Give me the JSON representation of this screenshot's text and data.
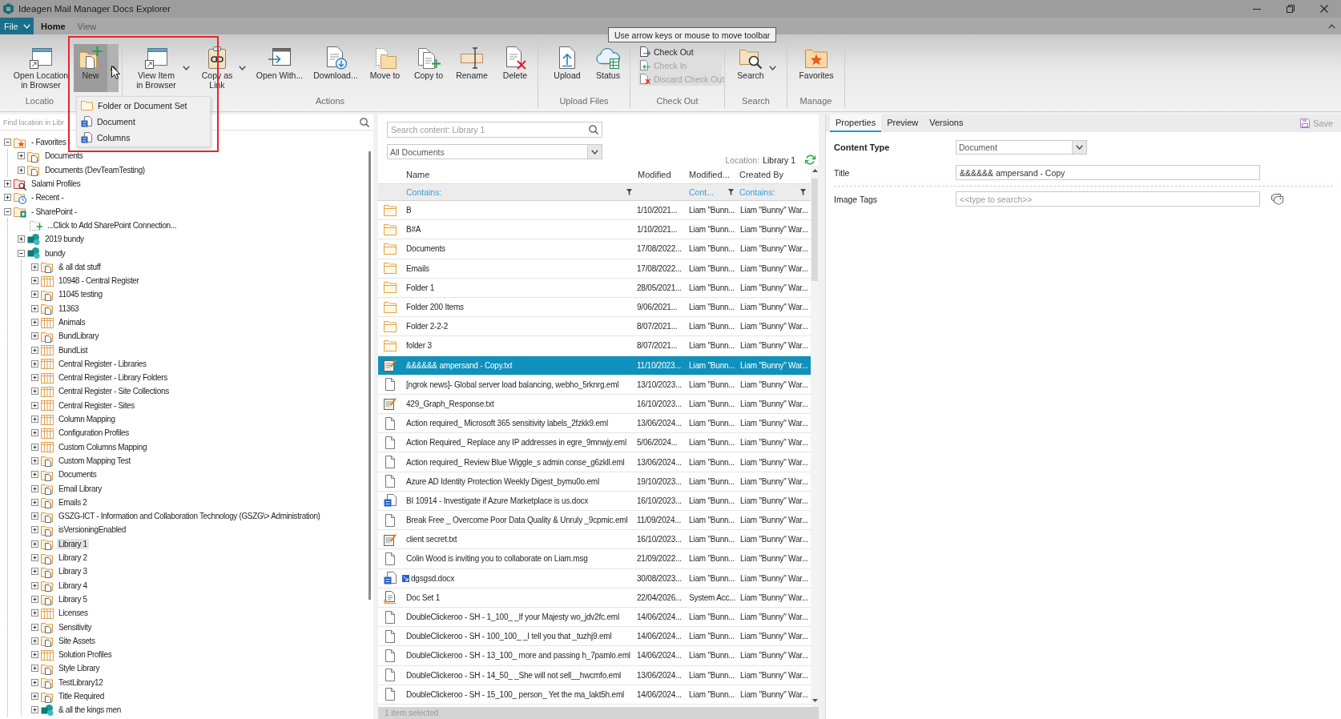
{
  "window": {
    "title": "Ideagen Mail Manager Docs Explorer"
  },
  "menu_tabs": [
    {
      "label": "File",
      "kind": "file",
      "selected": false
    },
    {
      "label": "Home",
      "kind": "tab",
      "selected": true
    },
    {
      "label": "View",
      "kind": "tab",
      "selected": false
    }
  ],
  "ribbon": {
    "groups": [
      {
        "buttons": [
          {
            "label": "Open Location\nin Browser",
            "kind": "large",
            "dropdown": false,
            "open": false,
            "disabled": false
          },
          {
            "label": "New",
            "kind": "large",
            "dropdown": true,
            "open": true,
            "disabled": false
          }
        ],
        "label": "Locatio"
      },
      {
        "buttons": [
          {
            "label": "View Item\nin Browser",
            "kind": "large",
            "dropdown": true,
            "open": false,
            "disabled": false
          },
          {
            "label": "Copy as\nLink",
            "kind": "large",
            "dropdown": true,
            "open": false,
            "disabled": false
          },
          {
            "label": "Open With...",
            "kind": "large",
            "dropdown": false,
            "open": false,
            "disabled": false
          },
          {
            "label": "Download...",
            "kind": "large",
            "dropdown": false,
            "open": false,
            "disabled": false
          },
          {
            "label": "Move to",
            "kind": "large",
            "dropdown": false,
            "open": false,
            "disabled": false
          },
          {
            "label": "Copy to",
            "kind": "large",
            "dropdown": false,
            "open": false,
            "disabled": false
          },
          {
            "label": "Rename",
            "kind": "large",
            "dropdown": false,
            "open": false,
            "disabled": false
          },
          {
            "label": "Delete",
            "kind": "large",
            "dropdown": false,
            "open": false,
            "disabled": false
          }
        ],
        "label": "Actions"
      },
      {
        "buttons": [
          {
            "label": "Upload",
            "kind": "large",
            "dropdown": false,
            "open": false,
            "disabled": false
          },
          {
            "label": "Status",
            "kind": "large",
            "dropdown": false,
            "open": false,
            "disabled": false
          }
        ],
        "label": "Upload Files"
      },
      {
        "buttons": [
          {
            "label": "Check Out",
            "kind": "small",
            "dropdown": false,
            "open": false,
            "disabled": false
          },
          {
            "label": "Check In",
            "kind": "small",
            "dropdown": false,
            "open": false,
            "disabled": true
          },
          {
            "label": "Discard Check Out",
            "kind": "small",
            "dropdown": false,
            "open": false,
            "disabled": true
          }
        ],
        "label": "Check Out"
      },
      {
        "buttons": [
          {
            "label": "Search",
            "kind": "large",
            "dropdown": true,
            "open": false,
            "disabled": false
          }
        ],
        "label": "Search"
      },
      {
        "buttons": [
          {
            "label": "Favorites",
            "kind": "large",
            "dropdown": false,
            "open": false,
            "disabled": false
          }
        ],
        "label": "Manage"
      }
    ]
  },
  "tooltip": {
    "text": "Use arrow keys or mouse to move toolbar"
  },
  "new_menu": {
    "items": [
      {
        "label": "Folder or Document Set",
        "kind": "folder"
      },
      {
        "label": "Document",
        "kind": "document"
      },
      {
        "label": "Columns",
        "kind": "document"
      }
    ]
  },
  "left_pane": {
    "find": {
      "placeholder": "Find location in Libr"
    },
    "tree": [
      {
        "label": "- Favorites -",
        "kind": "favorites",
        "expanded": true,
        "selected": false,
        "children": [
          {
            "label": "Documents",
            "kind": "library",
            "expanded": false,
            "selected": false
          },
          {
            "label": "Documents (DevTeamTesting)",
            "kind": "library",
            "expanded": false,
            "selected": false
          }
        ]
      },
      {
        "label": "Salami Profiles",
        "kind": "search",
        "expanded": false,
        "selected": false
      },
      {
        "label": "- Recent -",
        "kind": "recent",
        "expanded": false,
        "selected": false
      },
      {
        "label": "- SharePoint -",
        "kind": "sharepoint",
        "expanded": true,
        "selected": false,
        "children": [
          {
            "label": "...Click to Add SharePoint Connection...",
            "kind": "add",
            "selected": false
          },
          {
            "label": "2019 bundy",
            "kind": "site",
            "expanded": false,
            "selected": false
          },
          {
            "label": "bundy",
            "kind": "site",
            "expanded": true,
            "selected": false,
            "children": [
              {
                "label": "& all dat stuff",
                "kind": "library",
                "expanded": false,
                "selected": false
              },
              {
                "label": "10948 - Central Register",
                "kind": "list",
                "expanded": false,
                "selected": false
              },
              {
                "label": "11045 testing",
                "kind": "library",
                "expanded": false,
                "selected": false
              },
              {
                "label": "11363",
                "kind": "library",
                "expanded": false,
                "selected": false
              },
              {
                "label": "Animals",
                "kind": "list",
                "expanded": false,
                "selected": false
              },
              {
                "label": "BundLibrary",
                "kind": "library",
                "expanded": false,
                "selected": false
              },
              {
                "label": "BundList",
                "kind": "list",
                "expanded": false,
                "selected": false
              },
              {
                "label": "Central Register - Libraries",
                "kind": "list",
                "expanded": false,
                "selected": false
              },
              {
                "label": "Central Register - Library Folders",
                "kind": "list",
                "expanded": false,
                "selected": false
              },
              {
                "label": "Central Register - Site Collections",
                "kind": "list",
                "expanded": false,
                "selected": false
              },
              {
                "label": "Central Register - Sites",
                "kind": "list",
                "expanded": false,
                "selected": false
              },
              {
                "label": "Column Mapping",
                "kind": "list",
                "expanded": false,
                "selected": false
              },
              {
                "label": "Configuration Profiles",
                "kind": "list",
                "expanded": false,
                "selected": false
              },
              {
                "label": "Custom Columns Mapping",
                "kind": "list",
                "expanded": false,
                "selected": false
              },
              {
                "label": "Custom Mapping Test",
                "kind": "library",
                "expanded": false,
                "selected": false
              },
              {
                "label": "Documents",
                "kind": "library",
                "expanded": false,
                "selected": false
              },
              {
                "label": "Email Library",
                "kind": "library",
                "expanded": false,
                "selected": false
              },
              {
                "label": "Emails 2",
                "kind": "library",
                "expanded": false,
                "selected": false
              },
              {
                "label": "GSZG-ICT - Information and Collaboration Technology (GSZG\\> Administration)",
                "kind": "library",
                "expanded": false,
                "selected": false
              },
              {
                "label": "isVersioningEnabled",
                "kind": "library",
                "expanded": false,
                "selected": false
              },
              {
                "label": "Library 1",
                "kind": "library",
                "expanded": false,
                "selected": true
              },
              {
                "label": "Library 2",
                "kind": "library",
                "expanded": false,
                "selected": false
              },
              {
                "label": "Library 3",
                "kind": "library",
                "expanded": false,
                "selected": false
              },
              {
                "label": "Library 4",
                "kind": "library",
                "expanded": false,
                "selected": false
              },
              {
                "label": "Library 5",
                "kind": "library",
                "expanded": false,
                "selected": false
              },
              {
                "label": "Licenses",
                "kind": "list",
                "expanded": false,
                "selected": false
              },
              {
                "label": "Sensitivity",
                "kind": "library",
                "expanded": false,
                "selected": false
              },
              {
                "label": "Site Assets",
                "kind": "library",
                "expanded": false,
                "selected": false
              },
              {
                "label": "Solution Profiles",
                "kind": "list",
                "expanded": false,
                "selected": false
              },
              {
                "label": "Style Library",
                "kind": "library",
                "expanded": false,
                "selected": false
              },
              {
                "label": "TestLibrary12",
                "kind": "library",
                "expanded": false,
                "selected": false
              },
              {
                "label": "Title Required",
                "kind": "library",
                "expanded": false,
                "selected": false
              },
              {
                "label": "& all the kings men",
                "kind": "site",
                "expanded": false,
                "selected": false
              }
            ]
          }
        ]
      }
    ]
  },
  "content": {
    "search": {
      "placeholder": "Search content: Library 1"
    },
    "view": {
      "value": "All Documents"
    },
    "location": {
      "label": "Location:",
      "value": "Library 1"
    },
    "table": {
      "columns": [
        {
          "label": "Name",
          "filter": "Contains:"
        },
        {
          "label": "Modified"
        },
        {
          "label": "Modified...",
          "filter": "Cont..."
        },
        {
          "label": "Created By",
          "filter": "Contains:"
        }
      ],
      "rows": [
        {
          "kind": "folder",
          "name": "B",
          "modified": "1/10/2021...",
          "modified_by": "Liam \"Bunn...",
          "created_by": "Liam \"Bunny\" War...",
          "selected": false,
          "status_icon": false
        },
        {
          "kind": "folder",
          "name": "B#A",
          "modified": "1/10/2021...",
          "modified_by": "Liam \"Bunn...",
          "created_by": "Liam \"Bunny\" War...",
          "selected": false,
          "status_icon": false
        },
        {
          "kind": "folder",
          "name": "Documents",
          "modified": "17/08/2022...",
          "modified_by": "Liam \"Bunn...",
          "created_by": "Liam \"Bunny\" War...",
          "selected": false,
          "status_icon": false
        },
        {
          "kind": "folder",
          "name": "Emails",
          "modified": "17/08/2022...",
          "modified_by": "Liam \"Bunn...",
          "created_by": "Liam \"Bunny\" War...",
          "selected": false,
          "status_icon": false
        },
        {
          "kind": "folder",
          "name": "Folder 1",
          "modified": "28/05/2021...",
          "modified_by": "Liam \"Bunn...",
          "created_by": "Liam \"Bunny\" War...",
          "selected": false,
          "status_icon": false
        },
        {
          "kind": "folder",
          "name": "Folder 200 Items",
          "modified": "9/06/2021...",
          "modified_by": "Liam \"Bunn...",
          "created_by": "Liam \"Bunny\" War...",
          "selected": false,
          "status_icon": false
        },
        {
          "kind": "folder",
          "name": "Folder 2-2-2",
          "modified": "8/07/2021...",
          "modified_by": "Liam \"Bunn...",
          "created_by": "Liam \"Bunny\" War...",
          "selected": false,
          "status_icon": false
        },
        {
          "kind": "folder",
          "name": "folder 3",
          "modified": "8/07/2021...",
          "modified_by": "Liam \"Bunn...",
          "created_by": "Liam \"Bunny\" War...",
          "selected": false,
          "status_icon": false
        },
        {
          "kind": "text",
          "name": "&&&&&& ampersand - Copy.txt",
          "modified": "11/10/2023...",
          "modified_by": "Liam \"Bunn...",
          "created_by": "Liam \"Bunny\" War...",
          "selected": true,
          "status_icon": false
        },
        {
          "kind": "email",
          "name": "[ngrok news]- Global server load balancing, webho_5rknrg.eml",
          "modified": "13/10/2023...",
          "modified_by": "Liam \"Bunn...",
          "created_by": "Liam \"Bunny\" War...",
          "selected": false,
          "status_icon": false
        },
        {
          "kind": "text",
          "name": "429_Graph_Response.txt",
          "modified": "16/10/2023...",
          "modified_by": "Liam \"Bunn...",
          "created_by": "Liam \"Bunny\" War...",
          "selected": false,
          "status_icon": false
        },
        {
          "kind": "email",
          "name": "Action required_ Microsoft 365 sensitivity labels_2fzkk9.eml",
          "modified": "13/06/2024...",
          "modified_by": "Liam \"Bunn...",
          "created_by": "Liam \"Bunny\" War...",
          "selected": false,
          "status_icon": false
        },
        {
          "kind": "email",
          "name": "Action Required_ Replace any IP addresses in egre_9mnwjy.eml",
          "modified": "5/06/2024...",
          "modified_by": "Liam \"Bunn...",
          "created_by": "Liam \"Bunny\" War...",
          "selected": false,
          "status_icon": false
        },
        {
          "kind": "email",
          "name": "Action required_ Review Blue Wiggle_s admin conse_g6zkll.eml",
          "modified": "13/06/2024...",
          "modified_by": "Liam \"Bunn...",
          "created_by": "Liam \"Bunny\" War...",
          "selected": false,
          "status_icon": false
        },
        {
          "kind": "email",
          "name": "Azure AD Identity Protection Weekly Digest_bymu0o.eml",
          "modified": "19/10/2023...",
          "modified_by": "Liam \"Bunn...",
          "created_by": "Liam \"Bunny\" War...",
          "selected": false,
          "status_icon": false
        },
        {
          "kind": "word",
          "name": "BI 10914 - Investigate if Azure Marketplace is us.docx",
          "modified": "16/10/2023...",
          "modified_by": "Liam \"Bunn...",
          "created_by": "Liam \"Bunny\" War...",
          "selected": false,
          "status_icon": false
        },
        {
          "kind": "email",
          "name": "Break Free _ Overcome Poor Data Quality & Unruly _9cpmic.eml",
          "modified": "11/09/2024...",
          "modified_by": "Liam \"Bunn...",
          "created_by": "Liam \"Bunny\" War...",
          "selected": false,
          "status_icon": false
        },
        {
          "kind": "text",
          "name": "client secret.txt",
          "modified": "16/10/2023...",
          "modified_by": "Liam \"Bunn...",
          "created_by": "Liam \"Bunny\" War...",
          "selected": false,
          "status_icon": false
        },
        {
          "kind": "email",
          "name": "Colin Wood is inviting you to collaborate on Liam.msg",
          "modified": "21/09/2022...",
          "modified_by": "Liam \"Bunn...",
          "created_by": "Liam \"Bunny\" War...",
          "selected": false,
          "status_icon": false
        },
        {
          "kind": "word",
          "name": "dgsgsd.docx",
          "modified": "30/08/2023...",
          "modified_by": "Liam \"Bunn...",
          "created_by": "Liam \"Bunny\" War...",
          "selected": false,
          "status_icon": true
        },
        {
          "kind": "docset",
          "name": "Doc Set 1",
          "modified": "22/04/2026...",
          "modified_by": "System Acc...",
          "created_by": "Liam \"Bunny\" War...",
          "selected": false,
          "status_icon": false
        },
        {
          "kind": "email",
          "name": "DoubleClickeroo - SH - 1_100_ _If your Majesty wo_jdv2fc.eml",
          "modified": "14/06/2024...",
          "modified_by": "Liam \"Bunn...",
          "created_by": "Liam \"Bunny\" War...",
          "selected": false,
          "status_icon": false
        },
        {
          "kind": "email",
          "name": "DoubleClickeroo - SH - 100_100_ _I tell you that _tuzhj9.eml",
          "modified": "14/06/2024...",
          "modified_by": "Liam \"Bunn...",
          "created_by": "Liam \"Bunny\" War...",
          "selected": false,
          "status_icon": false
        },
        {
          "kind": "email",
          "name": "DoubleClickeroo - SH - 13_100_ more and passing h_7pamlo.eml",
          "modified": "14/06/2024...",
          "modified_by": "Liam \"Bunn...",
          "created_by": "Liam \"Bunny\" War...",
          "selected": false,
          "status_icon": false
        },
        {
          "kind": "email",
          "name": "DoubleClickeroo - SH - 14_50_ _She will not sell__hwcmfo.eml",
          "modified": "13/06/2024...",
          "modified_by": "Liam \"Bunn...",
          "created_by": "Liam \"Bunny\" War...",
          "selected": false,
          "status_icon": false
        },
        {
          "kind": "email",
          "name": "DoubleClickeroo - SH - 15_100_ person_ Yet the ma_lakt5h.eml",
          "modified": "14/06/2024...",
          "modified_by": "Liam \"Bunn...",
          "created_by": "Liam \"Bunny\" War...",
          "selected": false,
          "status_icon": false
        }
      ]
    },
    "status_bar": "1 item selected"
  },
  "details": {
    "tabs": [
      {
        "label": "Properties",
        "selected": true
      },
      {
        "label": "Preview",
        "selected": false
      },
      {
        "label": "Versions",
        "selected": false
      }
    ],
    "save": {
      "label": "Save",
      "disabled": true
    },
    "fields": [
      {
        "label": "Content Type",
        "kind": "content-type",
        "value": "Document"
      },
      {
        "label": "Title",
        "kind": "text",
        "value": "&&&&&& ampersand - Copy"
      },
      {
        "label": "Image Tags",
        "kind": "tags",
        "placeholder": "<<type to search>>"
      }
    ]
  }
}
